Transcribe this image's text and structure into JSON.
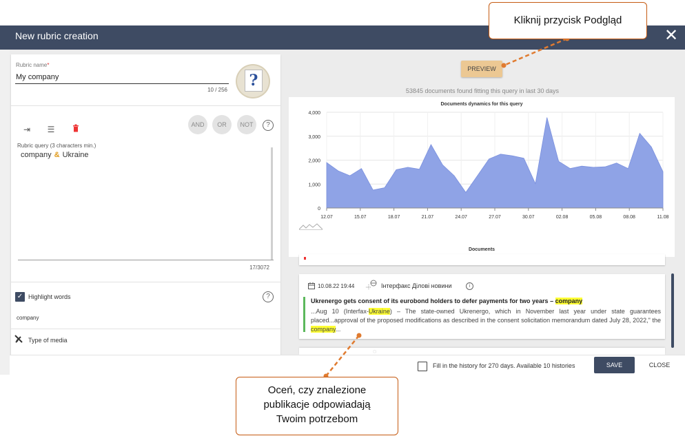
{
  "window": {
    "title": "New rubric creation"
  },
  "form": {
    "rubric_name_label": "Rubric name",
    "rubric_name_required": "*",
    "rubric_name_value": "My company",
    "name_counter": "10 / 256",
    "query_label": "Rubric query (3 characters min.)",
    "query_term_1": "company",
    "query_operator": "&",
    "query_term_2": "Ukraine",
    "query_counter": "17/3072",
    "and_label": "AND",
    "or_label": "OR",
    "not_label": "NOT",
    "help_glyph": "?",
    "highlight_label": "Highlight words",
    "highlight_checked": "✓",
    "highlight_words": "company",
    "type_of_media_label": "Type of media"
  },
  "preview": {
    "button_label": "PREVIEW",
    "docs_found": "53845 documents found fitting this query in last 30 days"
  },
  "chart_data": {
    "type": "area",
    "title": "Documents dynamics for this query",
    "x_ticks": [
      "12.07",
      "15.07",
      "18.07",
      "21.07",
      "24.07",
      "27.07",
      "30.07",
      "02.08",
      "05.08",
      "08.08",
      "11.08"
    ],
    "y_ticks": [
      "0",
      "1,000",
      "2,000",
      "3,000",
      "4,000"
    ],
    "ylim": [
      0,
      4000
    ],
    "xlim": [
      0,
      30
    ],
    "series": [
      {
        "values": [
          1900,
          1550,
          1350,
          1650,
          750,
          850,
          1600,
          1700,
          1620,
          2650,
          1800,
          1350,
          650,
          1350,
          2050,
          2250,
          2180,
          2080,
          1020,
          3780,
          1950,
          1650,
          1750,
          1700,
          1720,
          1880,
          1650,
          3120,
          2550,
          1520
        ]
      }
    ],
    "color": "#8fa3e6",
    "grid": true
  },
  "documents": {
    "heading": "Documents",
    "item": {
      "date": "10.08.22 19:44",
      "source": "Інтерфакс Ділові новини",
      "info_glyph": "i",
      "title_pre": "Ukrenergo gets consent of its eurobond holders to defer payments for two years – ",
      "title_hl": "company",
      "snip_1": "...Aug 10 (Interfax-",
      "snip_hl_1": "Ukraine",
      "snip_2": ") – The state-owned Ukrenergo, which in November last year under state guarantees placed...approval of the proposed modifications as described in the consent solicitation memorandum dated July 28, 2022,\" the ",
      "snip_hl_2": "company",
      "snip_3": "..."
    }
  },
  "footer": {
    "history_label": "Fill in the history for 270 days. Available 10 histories",
    "save_label": "SAVE",
    "close_label": "CLOSE"
  },
  "annotations": {
    "preview_callout": "Kliknij przycisk Podgląd",
    "docs_callout_1": "Oceń, czy znalezione",
    "docs_callout_2": "publikacje odpowiadają",
    "docs_callout_3": "Twoim potrzebom"
  },
  "colors": {
    "header": "#3e4b63",
    "accent_preview": "#ecc893",
    "callout_border": "#c55a11",
    "highlight": "#ffff33"
  }
}
